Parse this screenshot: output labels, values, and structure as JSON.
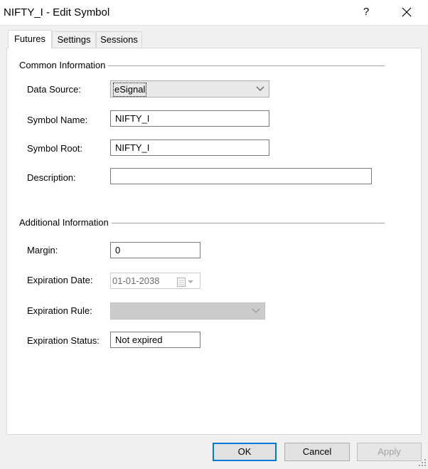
{
  "window": {
    "title": "NIFTY_I - Edit Symbol",
    "help_glyph": "?"
  },
  "tabs": [
    {
      "label": "Futures",
      "active": true
    },
    {
      "label": "Settings",
      "active": false
    },
    {
      "label": "Sessions",
      "active": false
    }
  ],
  "common": {
    "title": "Common Information",
    "data_source_label": "Data Source:",
    "data_source_value": "eSignal",
    "symbol_name_label": "Symbol Name:",
    "symbol_name_value": "NIFTY_I",
    "symbol_root_label": "Symbol Root:",
    "symbol_root_value": "NIFTY_I",
    "description_label": "Description:",
    "description_value": ""
  },
  "additional": {
    "title": "Additional Information",
    "margin_label": "Margin:",
    "margin_value": "0",
    "expiration_date_label": "Expiration Date:",
    "expiration_date_value": "01-01-2038",
    "expiration_rule_label": "Expiration Rule:",
    "expiration_rule_value": "",
    "expiration_status_label": "Expiration Status:",
    "expiration_status_value": "Not expired"
  },
  "buttons": {
    "ok": "OK",
    "cancel": "Cancel",
    "apply": "Apply"
  },
  "colors": {
    "focus_border": "#0078d7",
    "dialog_bg": "#f0f0f0",
    "panel_bg": "#ffffff"
  }
}
